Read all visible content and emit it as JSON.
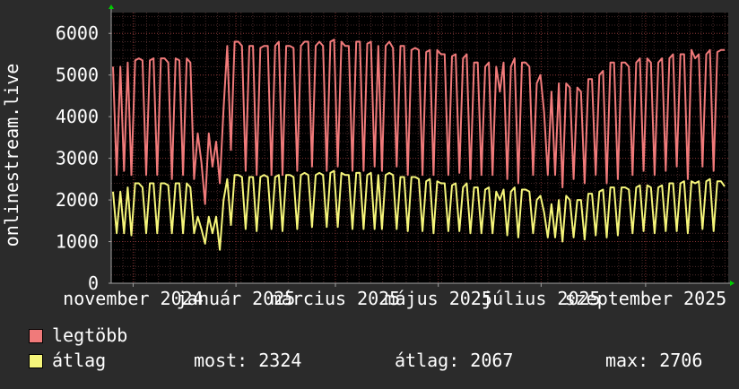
{
  "chart_data": {
    "type": "line",
    "ylabel": "onlinestream.live",
    "ylim": [
      0,
      6500
    ],
    "yticks": [
      0,
      1000,
      2000,
      3000,
      4000,
      5000,
      6000
    ],
    "x_range": [
      "2024-10-19",
      "2025-10-20"
    ],
    "xticks": [
      {
        "date": "2024-11-01",
        "label": "november 2024"
      },
      {
        "date": "2025-01-01",
        "label": "január 2025"
      },
      {
        "date": "2025-03-01",
        "label": "március 2025"
      },
      {
        "date": "2025-05-01",
        "label": "május 2025"
      },
      {
        "date": "2025-07-01",
        "label": "július 2025"
      },
      {
        "date": "2025-09-01",
        "label": "szeptember 2025"
      }
    ],
    "grid": true,
    "series_colors": {
      "max": "#f07a7a",
      "avg": "#f5f57a"
    },
    "series": [
      {
        "name": "legtöbb",
        "values": [
          5200,
          2600,
          5200,
          2700,
          5300,
          2600,
          5350,
          5400,
          5350,
          2600,
          5350,
          5400,
          2600,
          5400,
          5400,
          5300,
          2500,
          5400,
          5350,
          2600,
          5400,
          5300,
          2500,
          3600,
          2900,
          1900,
          3600,
          2800,
          3400,
          2400,
          4200,
          5700,
          3200,
          5800,
          5800,
          5700,
          2700,
          5700,
          5700,
          2600,
          5650,
          5700,
          5700,
          2600,
          5700,
          5800,
          2600,
          5700,
          5700,
          5650,
          2700,
          5700,
          5800,
          5800,
          2800,
          5700,
          5800,
          5700,
          2700,
          5800,
          5850,
          2800,
          5800,
          5700,
          5700,
          2700,
          5800,
          5800,
          2700,
          5750,
          5800,
          2800,
          5700,
          2700,
          5700,
          5800,
          5650,
          2800,
          5700,
          5700,
          2600,
          5600,
          5650,
          5600,
          2600,
          5550,
          5600,
          2600,
          5600,
          5500,
          5500,
          2600,
          5450,
          5500,
          2650,
          5400,
          5500,
          2500,
          5300,
          5300,
          2600,
          5200,
          5300,
          2600,
          5200,
          4600,
          5300,
          2500,
          5200,
          5400,
          2400,
          5300,
          5300,
          5200,
          2600,
          4800,
          5000,
          4100,
          2600,
          4600,
          2600,
          4800,
          2300,
          4800,
          4700,
          2500,
          4700,
          4600,
          2400,
          4900,
          4900,
          2600,
          5000,
          5100,
          2400,
          5300,
          5300,
          2500,
          5300,
          5300,
          5200,
          2600,
          5300,
          5400,
          2700,
          5400,
          5300,
          2600,
          5300,
          5400,
          2700,
          5400,
          5500,
          2800,
          5500,
          5500,
          2500,
          5600,
          5400,
          5500,
          2800,
          5500,
          5600,
          2700,
          5550,
          5600,
          5600
        ],
        "color": "#f07a7a"
      },
      {
        "name": "átlag",
        "values": [
          2200,
          1200,
          2200,
          1200,
          2300,
          1150,
          2400,
          2400,
          2300,
          1200,
          2400,
          2400,
          1200,
          2400,
          2400,
          2350,
          1200,
          2400,
          2400,
          1200,
          2400,
          2300,
          1200,
          1600,
          1300,
          950,
          1600,
          1200,
          1600,
          800,
          2000,
          2500,
          1400,
          2600,
          2600,
          2550,
          1300,
          2550,
          2550,
          1250,
          2550,
          2600,
          2550,
          1300,
          2550,
          2600,
          1250,
          2600,
          2600,
          2550,
          1300,
          2600,
          2650,
          2600,
          1350,
          2600,
          2650,
          2600,
          1350,
          2650,
          2700,
          1350,
          2650,
          2600,
          2600,
          1300,
          2650,
          2650,
          1300,
          2600,
          2650,
          1300,
          2600,
          1300,
          2600,
          2650,
          2600,
          1300,
          2550,
          2550,
          1250,
          2550,
          2550,
          2500,
          1250,
          2450,
          2500,
          1200,
          2450,
          2400,
          2400,
          1250,
          2350,
          2400,
          1250,
          2300,
          2400,
          1200,
          2300,
          2300,
          1200,
          2250,
          2300,
          1200,
          2200,
          2000,
          2250,
          1150,
          2200,
          2300,
          1100,
          2250,
          2250,
          2200,
          1200,
          2000,
          2100,
          1700,
          1100,
          1900,
          1100,
          2000,
          1000,
          2100,
          2000,
          1100,
          2000,
          2000,
          1050,
          2150,
          2150,
          1150,
          2200,
          2250,
          1100,
          2300,
          2300,
          1150,
          2300,
          2300,
          2250,
          1200,
          2300,
          2350,
          1250,
          2350,
          2300,
          1200,
          2300,
          2350,
          1250,
          2400,
          2400,
          1250,
          2400,
          2450,
          1200,
          2450,
          2400,
          2450,
          1300,
          2450,
          2500,
          1250,
          2450,
          2450,
          2324
        ],
        "color": "#f5f57a"
      }
    ],
    "legend_position": "bottom",
    "stats": {
      "now": "most: 2324",
      "avg": "átlag: 2067",
      "max": "max: 2706"
    }
  },
  "legend": {
    "max_label": "legtöbb",
    "avg_label": "átlag"
  }
}
